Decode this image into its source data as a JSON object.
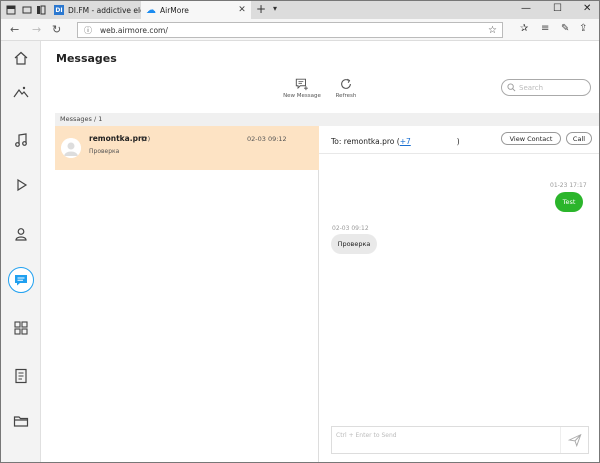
{
  "browser": {
    "tabs": [
      {
        "label": "DI.FM - addictive electr",
        "favicon": "DI"
      },
      {
        "label": "AirMore",
        "favicon": "airmore-icon"
      }
    ],
    "url": "web.airmore.com/"
  },
  "app": {
    "page_title": "Messages",
    "toolbar": {
      "new_message": "New Message",
      "refresh": "Refresh",
      "search_placeholder": "Search"
    },
    "breadcrumb": "Messages / 1",
    "conversations": [
      {
        "name": "remontka.pro",
        "count": "(2)",
        "time": "02-03 09:12",
        "preview": "Проверка"
      }
    ],
    "chat": {
      "to_label": "To: remontka.pro (",
      "to_number": "+7",
      "to_close": ")",
      "view_contact": "View Contact",
      "call": "Call",
      "messages": [
        {
          "time": "01-23 17:17",
          "text": "Test",
          "direction": "out"
        },
        {
          "time": "02-03 09:12",
          "text": "Проверка",
          "direction": "in"
        }
      ],
      "compose_placeholder": "Ctrl + Enter to Send"
    }
  },
  "colors": {
    "accent": "#20a0f0",
    "selected_row": "#fde3c4",
    "outgoing_bubble": "#2bb52b",
    "incoming_bubble": "#e9e9e9"
  }
}
